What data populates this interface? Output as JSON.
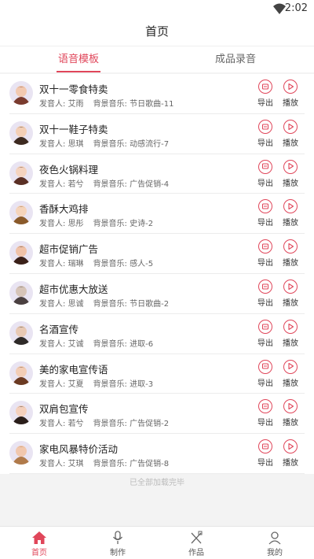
{
  "status": {
    "time": "2:02"
  },
  "header": {
    "title": "首页"
  },
  "tabs": [
    {
      "label": "语音模板",
      "active": true
    },
    {
      "label": "成品录音",
      "active": false
    }
  ],
  "labels": {
    "speaker_prefix": "发音人:",
    "music_prefix": "背景音乐:",
    "export": "导出",
    "play": "播放"
  },
  "items": [
    {
      "title": "双十一零食特卖",
      "speaker": "艾雨",
      "music": "节日歌曲-11"
    },
    {
      "title": "双十一鞋子特卖",
      "speaker": "思琪",
      "music": "动感流行-7"
    },
    {
      "title": "夜色火锅料理",
      "speaker": "若兮",
      "music": "广告促销-4"
    },
    {
      "title": "香酥大鸡排",
      "speaker": "思彤",
      "music": "史诗-2"
    },
    {
      "title": "超市促销广告",
      "speaker": "瑞琳",
      "music": "感人-5"
    },
    {
      "title": "超市优惠大放送",
      "speaker": "思诚",
      "music": "节日歌曲-2"
    },
    {
      "title": "名酒宣传",
      "speaker": "艾诚",
      "music": "进取-6"
    },
    {
      "title": "美的家电宣传语",
      "speaker": "艾夏",
      "music": "进取-3"
    },
    {
      "title": "双肩包宣传",
      "speaker": "若兮",
      "music": "广告促销-2"
    },
    {
      "title": "家电风暴特价活动",
      "speaker": "艾琪",
      "music": "广告促销-8"
    }
  ],
  "end_note": "已全部加载完毕",
  "bottom_nav": [
    {
      "label": "首页",
      "icon": "home-icon",
      "active": true
    },
    {
      "label": "制作",
      "icon": "microphone-icon",
      "active": false
    },
    {
      "label": "作品",
      "icon": "pencil-ruler-icon",
      "active": false
    },
    {
      "label": "我的",
      "icon": "user-icon",
      "active": false
    }
  ],
  "colors": {
    "accent": "#e0465a"
  }
}
